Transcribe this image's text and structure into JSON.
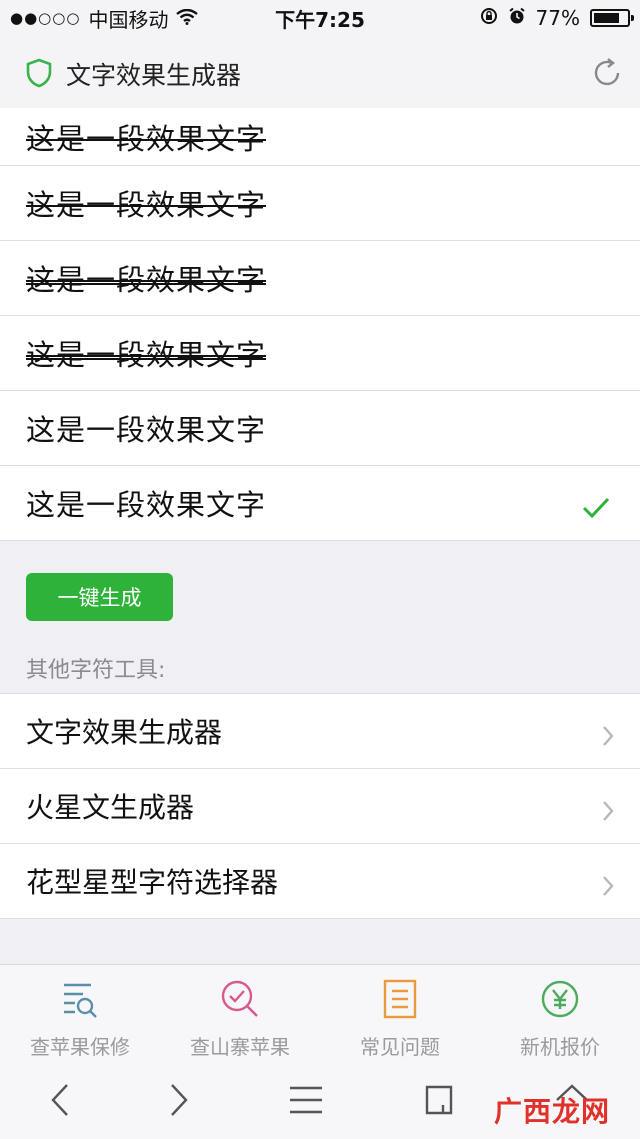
{
  "status": {
    "signal_dots": "●●○○○",
    "carrier": "中国移动",
    "time": "下午7:25",
    "battery": "77%",
    "battery_level": 0.77
  },
  "header": {
    "title": "文字效果生成器",
    "icons": [
      "shield-icon",
      "refresh-icon"
    ]
  },
  "effects": [
    {
      "text": "这是一段效果文字",
      "style": "strike"
    },
    {
      "text": "这是一段效果文字",
      "style": "strike-bold"
    },
    {
      "text": "这是一段效果文字",
      "style": "double-strike"
    },
    {
      "text": "这是一段效果文字",
      "style": "boxed"
    },
    {
      "text": "这是一段效果文字",
      "style": "marks"
    },
    {
      "text": "这是一段效果文字",
      "style": "marks-selected",
      "selected": true
    }
  ],
  "generate_button": "一键生成",
  "section_label": "其他字符工具:",
  "tools": [
    {
      "label": "文字效果生成器"
    },
    {
      "label": "火星文生成器"
    },
    {
      "label": "花型星型字符选择器"
    }
  ],
  "tabbar": [
    {
      "label": "查苹果保修",
      "icon": "list-search-icon",
      "color": "#5b8fa8"
    },
    {
      "label": "查山寨苹果",
      "icon": "magnify-check-icon",
      "color": "#d65a8e"
    },
    {
      "label": "常见问题",
      "icon": "document-icon",
      "color": "#e89a3c"
    },
    {
      "label": "新机报价",
      "icon": "yen-icon",
      "color": "#4cab5c"
    }
  ],
  "browser": {
    "icons": [
      "back-icon",
      "forward-icon",
      "menu-icon",
      "tabs-icon",
      "home-icon"
    ]
  },
  "watermark": "广西龙网",
  "colors": {
    "accent": "#2eb239",
    "check": "#2eb239"
  }
}
